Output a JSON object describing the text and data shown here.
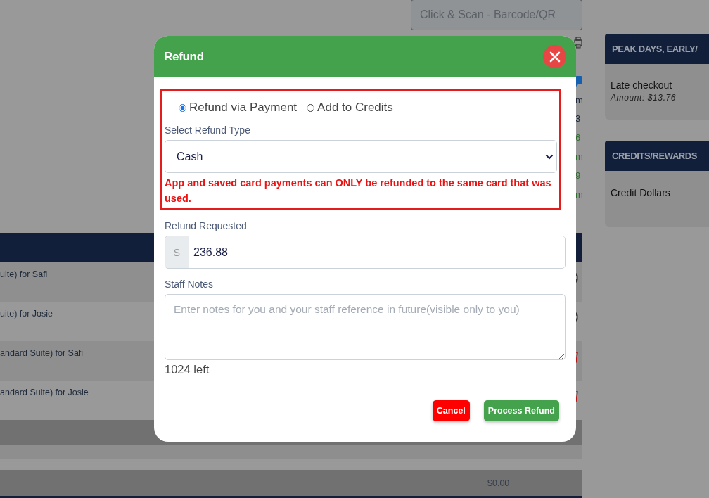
{
  "search": {
    "placeholder": "Click & Scan - Barcode/QR"
  },
  "fragments": [
    {
      "text": "m",
      "kind": "plain"
    },
    {
      "text": "3",
      "kind": "plain"
    },
    {
      "text": "6",
      "kind": "green"
    },
    {
      "text": "m",
      "kind": "green"
    },
    {
      "text": "9",
      "kind": "green"
    },
    {
      "text": "m",
      "kind": "green"
    }
  ],
  "table": {
    "rows": [
      {
        "text": "uite) for Safi",
        "kind": "print"
      },
      {
        "text": "uite) for Josie",
        "kind": "print"
      },
      {
        "text": "andard Suite) for Safi",
        "kind": "delete"
      },
      {
        "text": "andard Suite) for Josie",
        "kind": "delete"
      }
    ],
    "total": "$0.00"
  },
  "sidebar": {
    "cards": [
      {
        "title": "PEAK DAYS, EARLY/",
        "item": "Late checkout",
        "detail": "Amount: $13.76"
      },
      {
        "title": "CREDITS/REWARDS",
        "item": "Credit Dollars"
      }
    ]
  },
  "modal": {
    "title": "Refund",
    "options": [
      {
        "label": "Refund via Payment",
        "selected": true
      },
      {
        "label": "Add to Credits",
        "selected": false
      }
    ],
    "refund_type": {
      "label": "Select Refund Type",
      "value": "Cash"
    },
    "warning": "App and saved card payments can ONLY be refunded to the same card that was used.",
    "amount": {
      "label": "Refund Requested",
      "prefix": "$",
      "value": "236.88"
    },
    "notes": {
      "label": "Staff Notes",
      "placeholder": "Enter notes for you and your staff reference in future(visible only to you)",
      "counter": "1024 left"
    },
    "buttons": [
      {
        "label": "Cancel",
        "kind": "danger"
      },
      {
        "label": "Process Refund",
        "kind": "primary"
      }
    ]
  }
}
